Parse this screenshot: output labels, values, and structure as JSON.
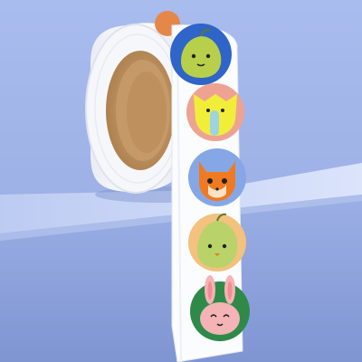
{
  "scene": {
    "subject": "sticker-roll",
    "colors": {
      "wall": "#a3b7ea",
      "shelf_top": "#c9d6f6",
      "shelf_front": "#8ea3dc",
      "paper": "#f7f8fb",
      "core": "#c9a070",
      "core_dark": "#a77c4c"
    },
    "stickers": [
      {
        "character": "pear",
        "bg": "#2f64c8",
        "face": "#b8cf4c"
      },
      {
        "character": "elephant",
        "bg": "#eea392",
        "face": "#f1ee3a"
      },
      {
        "character": "fox",
        "bg": "#86a7e6",
        "face": "#f07a22"
      },
      {
        "character": "pear",
        "bg": "#f2c27e",
        "face": "#b9d36a"
      },
      {
        "character": "bunny",
        "bg": "#2f8a4a",
        "face": "#f4b3b5"
      }
    ]
  }
}
